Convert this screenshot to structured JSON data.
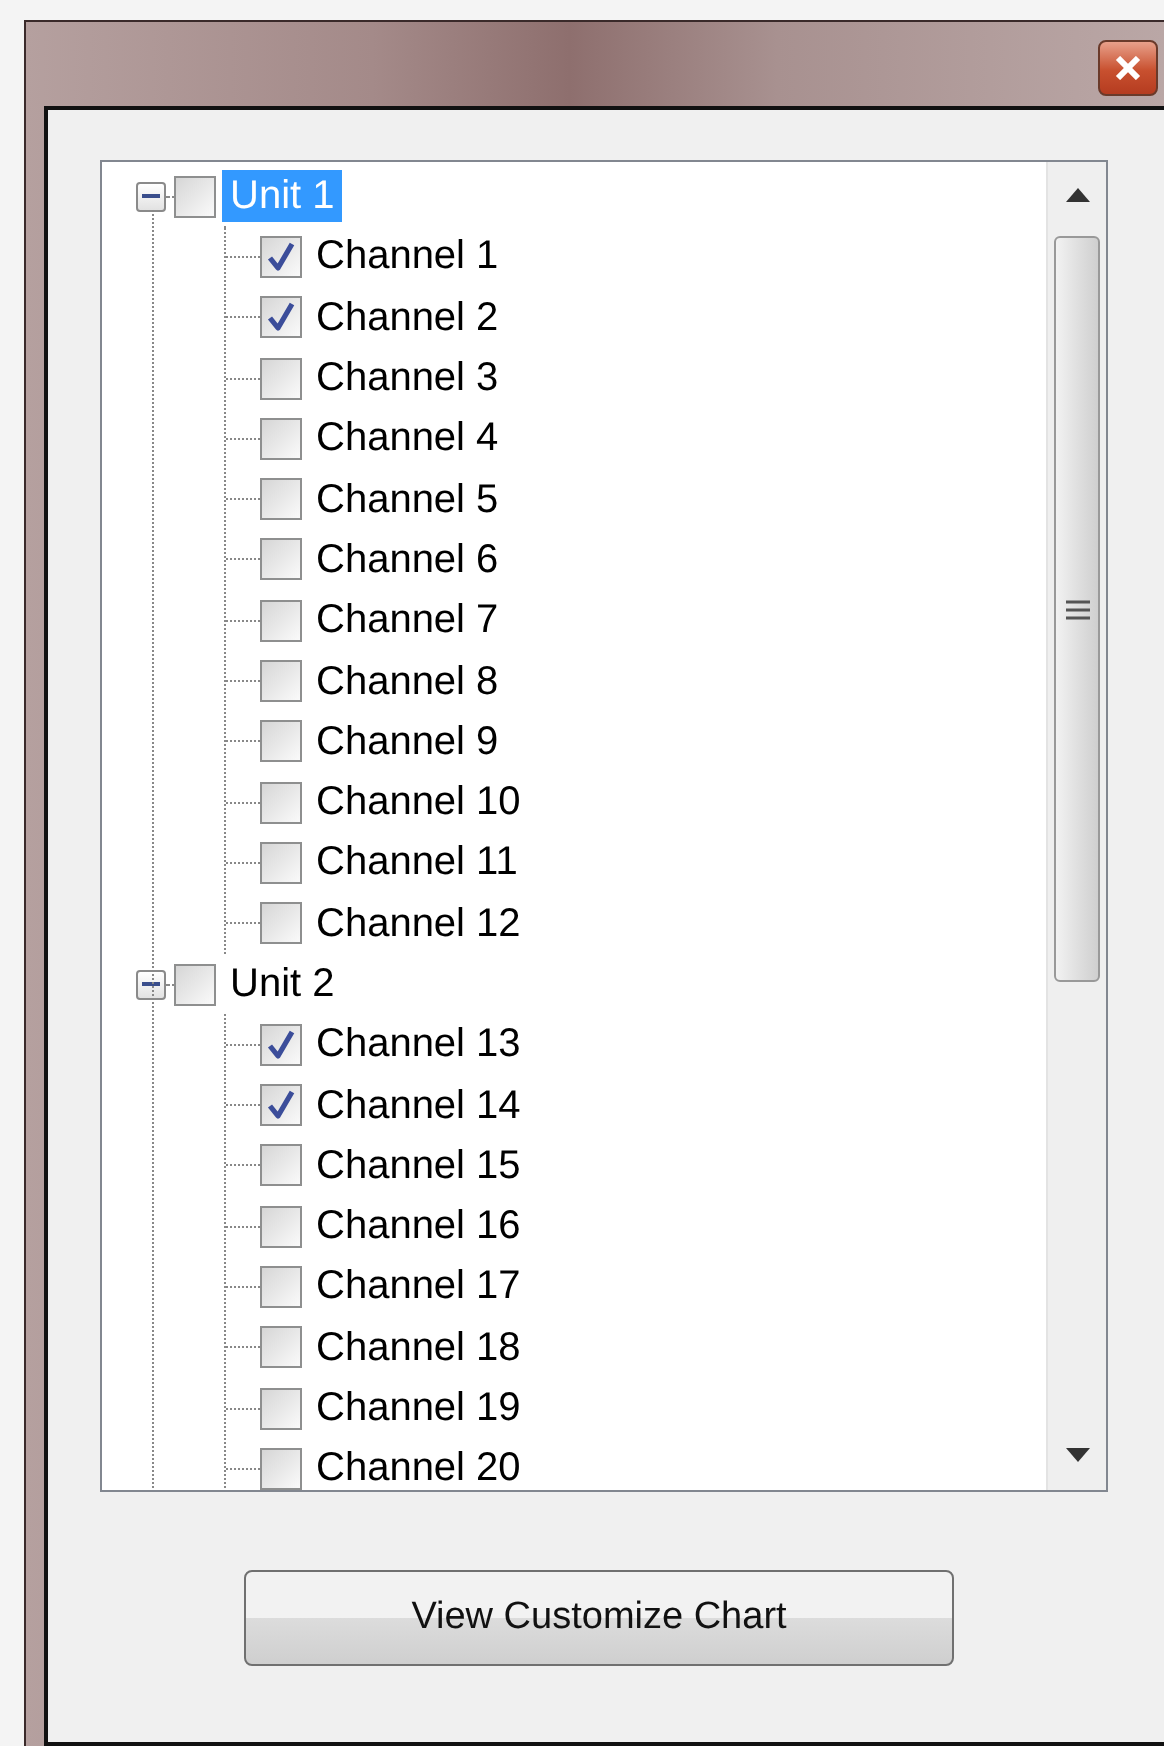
{
  "tree": [
    {
      "label": "Unit 1",
      "expanded": true,
      "checked": false,
      "selected": true,
      "children": [
        {
          "label": "Channel 1",
          "checked": true,
          "selected": false
        },
        {
          "label": "Channel 2",
          "checked": true,
          "selected": false
        },
        {
          "label": "Channel 3",
          "checked": false,
          "selected": false
        },
        {
          "label": "Channel 4",
          "checked": false,
          "selected": false
        },
        {
          "label": "Channel 5",
          "checked": false,
          "selected": false
        },
        {
          "label": "Channel 6",
          "checked": false,
          "selected": false
        },
        {
          "label": "Channel 7",
          "checked": false,
          "selected": false
        },
        {
          "label": "Channel 8",
          "checked": false,
          "selected": false
        },
        {
          "label": "Channel 9",
          "checked": false,
          "selected": false
        },
        {
          "label": "Channel 10",
          "checked": false,
          "selected": false
        },
        {
          "label": "Channel 11",
          "checked": false,
          "selected": false
        },
        {
          "label": "Channel 12",
          "checked": false,
          "selected": false
        }
      ]
    },
    {
      "label": "Unit 2",
      "expanded": true,
      "checked": false,
      "selected": false,
      "children": [
        {
          "label": "Channel 13",
          "checked": true,
          "selected": false
        },
        {
          "label": "Channel 14",
          "checked": true,
          "selected": false
        },
        {
          "label": "Channel 15",
          "checked": false,
          "selected": false
        },
        {
          "label": "Channel 16",
          "checked": false,
          "selected": false
        },
        {
          "label": "Channel 17",
          "checked": false,
          "selected": false
        },
        {
          "label": "Channel 18",
          "checked": false,
          "selected": false
        },
        {
          "label": "Channel 19",
          "checked": false,
          "selected": false
        },
        {
          "label": "Channel 20",
          "checked": false,
          "selected": false
        }
      ]
    }
  ],
  "button": {
    "label": "View Customize Chart"
  }
}
